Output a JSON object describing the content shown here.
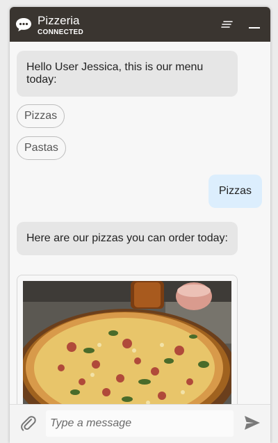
{
  "header": {
    "title": "Pizzeria",
    "status": "CONNECTED",
    "background": "#3a3530"
  },
  "messages": {
    "greeting": "Hello User Jessica, this is our menu today:",
    "options": [
      "Pizzas",
      "Pastas"
    ],
    "user_reply": "Pizzas",
    "pizza_intro": "Here are our pizzas you can order today:",
    "bot_bubble_color": "#e6e6e6",
    "user_bubble_color": "#dceefd"
  },
  "composer": {
    "placeholder": "Type a message",
    "attach_icon": "paperclip-icon",
    "send_icon": "send-icon"
  }
}
